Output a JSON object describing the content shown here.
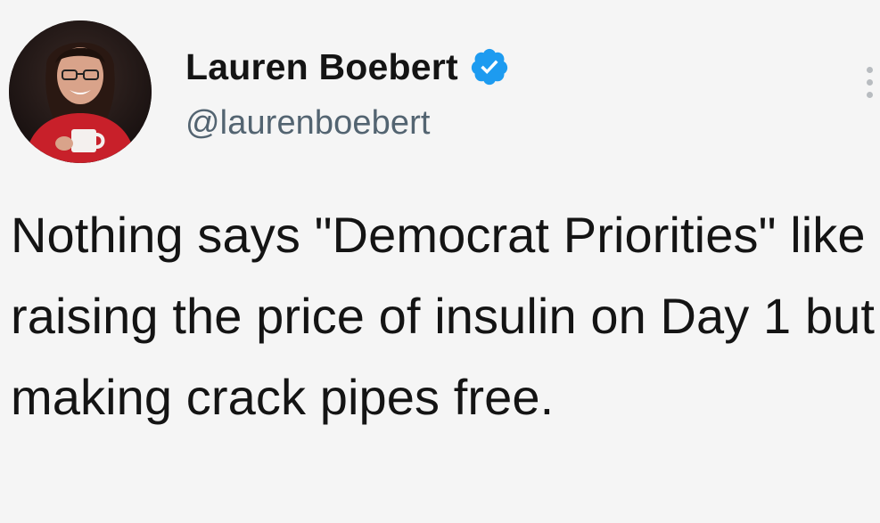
{
  "tweet": {
    "author": {
      "display_name": "Lauren Boebert",
      "handle": "@laurenboebert",
      "verified": true,
      "avatar_icon": "profile-photo",
      "verified_icon": "verified-badge-icon"
    },
    "text": "Nothing says \"Democrat Priorities\" like raising the price of insulin on Day 1 but making crack pipes free.",
    "more_icon": "more-options-icon"
  },
  "colors": {
    "background": "#f5f5f5",
    "text_primary": "#141414",
    "text_secondary": "#536471",
    "verified_blue": "#1d9bf0"
  }
}
